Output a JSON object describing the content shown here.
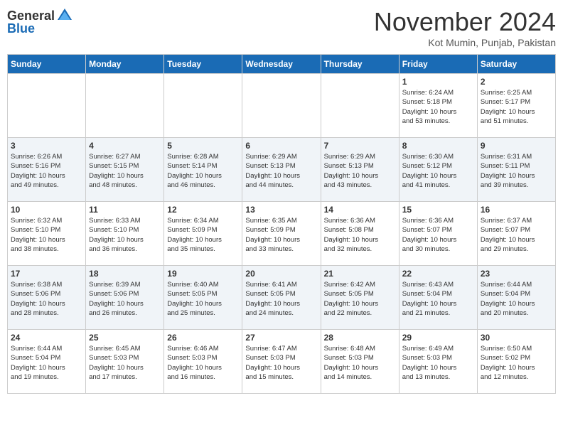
{
  "header": {
    "logo_general": "General",
    "logo_blue": "Blue",
    "month_title": "November 2024",
    "location": "Kot Mumin, Punjab, Pakistan"
  },
  "days_of_week": [
    "Sunday",
    "Monday",
    "Tuesday",
    "Wednesday",
    "Thursday",
    "Friday",
    "Saturday"
  ],
  "weeks": [
    [
      {
        "day": "",
        "info": ""
      },
      {
        "day": "",
        "info": ""
      },
      {
        "day": "",
        "info": ""
      },
      {
        "day": "",
        "info": ""
      },
      {
        "day": "",
        "info": ""
      },
      {
        "day": "1",
        "info": "Sunrise: 6:24 AM\nSunset: 5:18 PM\nDaylight: 10 hours\nand 53 minutes."
      },
      {
        "day": "2",
        "info": "Sunrise: 6:25 AM\nSunset: 5:17 PM\nDaylight: 10 hours\nand 51 minutes."
      }
    ],
    [
      {
        "day": "3",
        "info": "Sunrise: 6:26 AM\nSunset: 5:16 PM\nDaylight: 10 hours\nand 49 minutes."
      },
      {
        "day": "4",
        "info": "Sunrise: 6:27 AM\nSunset: 5:15 PM\nDaylight: 10 hours\nand 48 minutes."
      },
      {
        "day": "5",
        "info": "Sunrise: 6:28 AM\nSunset: 5:14 PM\nDaylight: 10 hours\nand 46 minutes."
      },
      {
        "day": "6",
        "info": "Sunrise: 6:29 AM\nSunset: 5:13 PM\nDaylight: 10 hours\nand 44 minutes."
      },
      {
        "day": "7",
        "info": "Sunrise: 6:29 AM\nSunset: 5:13 PM\nDaylight: 10 hours\nand 43 minutes."
      },
      {
        "day": "8",
        "info": "Sunrise: 6:30 AM\nSunset: 5:12 PM\nDaylight: 10 hours\nand 41 minutes."
      },
      {
        "day": "9",
        "info": "Sunrise: 6:31 AM\nSunset: 5:11 PM\nDaylight: 10 hours\nand 39 minutes."
      }
    ],
    [
      {
        "day": "10",
        "info": "Sunrise: 6:32 AM\nSunset: 5:10 PM\nDaylight: 10 hours\nand 38 minutes."
      },
      {
        "day": "11",
        "info": "Sunrise: 6:33 AM\nSunset: 5:10 PM\nDaylight: 10 hours\nand 36 minutes."
      },
      {
        "day": "12",
        "info": "Sunrise: 6:34 AM\nSunset: 5:09 PM\nDaylight: 10 hours\nand 35 minutes."
      },
      {
        "day": "13",
        "info": "Sunrise: 6:35 AM\nSunset: 5:09 PM\nDaylight: 10 hours\nand 33 minutes."
      },
      {
        "day": "14",
        "info": "Sunrise: 6:36 AM\nSunset: 5:08 PM\nDaylight: 10 hours\nand 32 minutes."
      },
      {
        "day": "15",
        "info": "Sunrise: 6:36 AM\nSunset: 5:07 PM\nDaylight: 10 hours\nand 30 minutes."
      },
      {
        "day": "16",
        "info": "Sunrise: 6:37 AM\nSunset: 5:07 PM\nDaylight: 10 hours\nand 29 minutes."
      }
    ],
    [
      {
        "day": "17",
        "info": "Sunrise: 6:38 AM\nSunset: 5:06 PM\nDaylight: 10 hours\nand 28 minutes."
      },
      {
        "day": "18",
        "info": "Sunrise: 6:39 AM\nSunset: 5:06 PM\nDaylight: 10 hours\nand 26 minutes."
      },
      {
        "day": "19",
        "info": "Sunrise: 6:40 AM\nSunset: 5:05 PM\nDaylight: 10 hours\nand 25 minutes."
      },
      {
        "day": "20",
        "info": "Sunrise: 6:41 AM\nSunset: 5:05 PM\nDaylight: 10 hours\nand 24 minutes."
      },
      {
        "day": "21",
        "info": "Sunrise: 6:42 AM\nSunset: 5:05 PM\nDaylight: 10 hours\nand 22 minutes."
      },
      {
        "day": "22",
        "info": "Sunrise: 6:43 AM\nSunset: 5:04 PM\nDaylight: 10 hours\nand 21 minutes."
      },
      {
        "day": "23",
        "info": "Sunrise: 6:44 AM\nSunset: 5:04 PM\nDaylight: 10 hours\nand 20 minutes."
      }
    ],
    [
      {
        "day": "24",
        "info": "Sunrise: 6:44 AM\nSunset: 5:04 PM\nDaylight: 10 hours\nand 19 minutes."
      },
      {
        "day": "25",
        "info": "Sunrise: 6:45 AM\nSunset: 5:03 PM\nDaylight: 10 hours\nand 17 minutes."
      },
      {
        "day": "26",
        "info": "Sunrise: 6:46 AM\nSunset: 5:03 PM\nDaylight: 10 hours\nand 16 minutes."
      },
      {
        "day": "27",
        "info": "Sunrise: 6:47 AM\nSunset: 5:03 PM\nDaylight: 10 hours\nand 15 minutes."
      },
      {
        "day": "28",
        "info": "Sunrise: 6:48 AM\nSunset: 5:03 PM\nDaylight: 10 hours\nand 14 minutes."
      },
      {
        "day": "29",
        "info": "Sunrise: 6:49 AM\nSunset: 5:03 PM\nDaylight: 10 hours\nand 13 minutes."
      },
      {
        "day": "30",
        "info": "Sunrise: 6:50 AM\nSunset: 5:02 PM\nDaylight: 10 hours\nand 12 minutes."
      }
    ]
  ]
}
